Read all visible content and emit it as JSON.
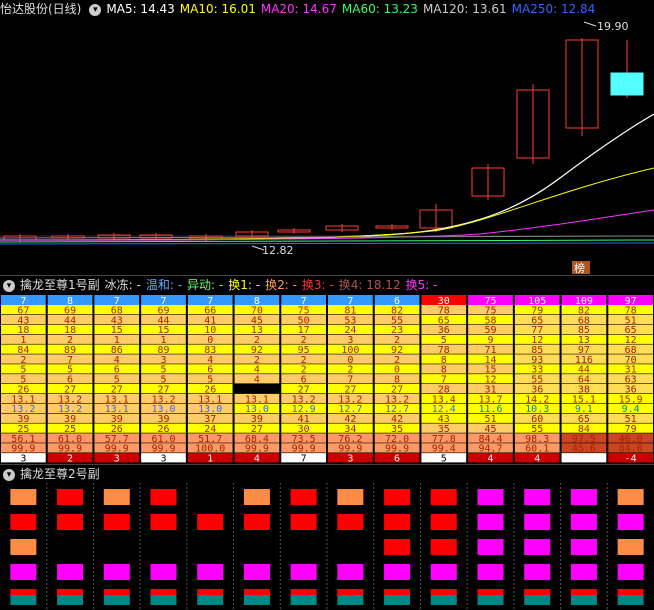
{
  "panel1": {
    "title": "怡达股份(日线)",
    "ma": [
      {
        "label": "MA5: 14.43",
        "color": "#ffffff"
      },
      {
        "label": "MA10: 16.01",
        "color": "#ffff00"
      },
      {
        "label": "MA20: 14.67",
        "color": "#ff33ff"
      },
      {
        "label": "MA60: 13.23",
        "color": "#33ff66"
      },
      {
        "label": "MA120: 13.61",
        "color": "#cccccc"
      },
      {
        "label": "MA250: 12.84",
        "color": "#3366ff"
      }
    ],
    "high_label": "19.90",
    "low_label": "12.82",
    "rank_badge": "榜"
  },
  "panel2": {
    "title": "擒龙至尊1号副",
    "indicators": [
      {
        "label": "冰冻: -",
        "color": "#dddddd"
      },
      {
        "label": "温和: -",
        "color": "#66aaff"
      },
      {
        "label": "异动: -",
        "color": "#66ff66"
      },
      {
        "label": "换1: -",
        "color": "#ffff00"
      },
      {
        "label": "换2: -",
        "color": "#ff9966"
      },
      {
        "label": "换3: -",
        "color": "#ff3333"
      },
      {
        "label": "换4: 18.12",
        "color": "#aa5555"
      },
      {
        "label": "换5: -",
        "color": "#ff33ff"
      }
    ],
    "header_values": [
      "7",
      "8",
      "7",
      "7",
      "7",
      "8",
      "7",
      "7",
      "6",
      "30",
      "75",
      "105",
      "109",
      "97"
    ],
    "rows": [
      [
        "67",
        "69",
        "68",
        "69",
        "66",
        "70",
        "75",
        "81",
        "82",
        "78",
        "75",
        "79",
        "82",
        "78"
      ],
      [
        "43",
        "44",
        "43",
        "44",
        "41",
        "45",
        "50",
        "53",
        "55",
        "65",
        "58",
        "65",
        "68",
        "51"
      ],
      [
        "18",
        "18",
        "15",
        "15",
        "10",
        "13",
        "17",
        "24",
        "23",
        "36",
        "59",
        "77",
        "85",
        "65"
      ],
      [
        "1",
        "2",
        "1",
        "1",
        "0",
        "2",
        "2",
        "3",
        "2",
        "5",
        "9",
        "12",
        "13",
        "12"
      ],
      [
        "84",
        "89",
        "86",
        "89",
        "83",
        "92",
        "95",
        "100",
        "92",
        "78",
        "71",
        "85",
        "97",
        "68"
      ],
      [
        "2",
        "7",
        "4",
        "3",
        "4",
        "2",
        "2",
        "0",
        "2",
        "8",
        "14",
        "93",
        "116",
        "70"
      ],
      [
        "5",
        "5",
        "6",
        "5",
        "6",
        "4",
        "2",
        "2",
        "0",
        "8",
        "15",
        "33",
        "44",
        "31"
      ],
      [
        "5",
        "6",
        "5",
        "5",
        "5",
        "4",
        "6",
        "7",
        "8",
        "7",
        "12",
        "55",
        "64",
        "63",
        "26"
      ],
      [
        "26",
        "27",
        "27",
        "27",
        "26",
        "",
        "27",
        "27",
        "27",
        "28",
        "31",
        "36",
        "38",
        "36"
      ],
      [
        "13.1",
        "13.2",
        "13.1",
        "13.2",
        "13.1",
        "13.1",
        "13.2",
        "13.2",
        "13.2",
        "13.4",
        "13.7",
        "14.2",
        "15.1",
        "15.9"
      ],
      [
        "13.2",
        "13.2",
        "13.1",
        "13.0",
        "13.0",
        "13.0",
        "12.9",
        "12.7",
        "12.7",
        "12.4",
        "11.6",
        "10.3",
        "9.1",
        "9.4"
      ],
      [
        "39",
        "39",
        "39",
        "39",
        "37",
        "39",
        "41",
        "42",
        "42",
        "43",
        "51",
        "60",
        "65",
        "51"
      ],
      [
        "25",
        "25",
        "26",
        "26",
        "24",
        "27",
        "30",
        "34",
        "35",
        "35",
        "45",
        "55",
        "84",
        "79"
      ],
      [
        "56.1",
        "61.0",
        "57.7",
        "61.0",
        "51.7",
        "68.4",
        "73.5",
        "76.2",
        "72.0",
        "77.8",
        "84.4",
        "98.3",
        "97.5",
        "46.0"
      ],
      [
        "99.9",
        "99.9",
        "99.9",
        "99.9",
        "100.0",
        "99.9",
        "99.9",
        "99.9",
        "99.9",
        "99.4",
        "94.7",
        "60.1",
        "45.6",
        "84.0"
      ],
      [
        "3",
        "2",
        "3",
        "3",
        "1",
        "4",
        "7",
        "3",
        "6",
        "5",
        "4",
        "4",
        "",
        "-4"
      ]
    ]
  },
  "panel3": {
    "title": "擒龙至尊2号副",
    "grid": [
      [
        "o",
        "r",
        "o",
        "r",
        "",
        "o",
        "r",
        "o",
        "r",
        "r",
        "m",
        "m",
        "m",
        "o"
      ],
      [
        "r",
        "r",
        "r",
        "r",
        "r",
        "r",
        "r",
        "r",
        "r",
        "r",
        "m",
        "m",
        "m",
        "m"
      ],
      [
        "o",
        "",
        "",
        "",
        "",
        "",
        "",
        "",
        "r",
        "r",
        "m",
        "m",
        "m",
        "o"
      ],
      [
        "m",
        "m",
        "m",
        "m",
        "m",
        "m",
        "m",
        "m",
        "m",
        "m",
        "m",
        "m",
        "m",
        "m"
      ],
      [
        "t",
        "t",
        "t",
        "t",
        "t",
        "t",
        "t",
        "t",
        "t",
        "t",
        "t",
        "t",
        "t",
        "t"
      ]
    ]
  },
  "colors": {
    "up": "#ff3c3c",
    "down": "#54ffff",
    "grid": "#333333",
    "orange": "#ff8c46",
    "red": "#ff0000",
    "magenta": "#ff00ff",
    "teal": "#008888"
  }
}
